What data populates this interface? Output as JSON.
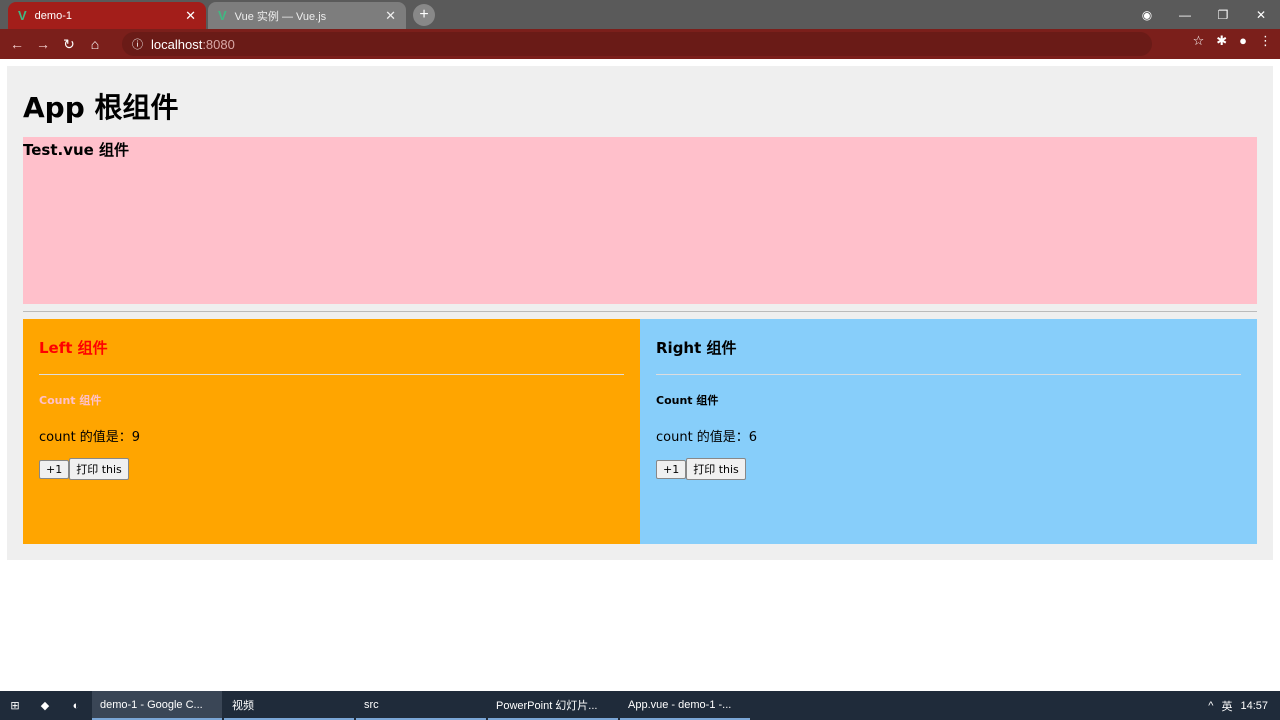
{
  "browser": {
    "tabs": [
      {
        "title": "demo-1",
        "active": true
      },
      {
        "title": "Vue 实例 — Vue.js",
        "active": false
      }
    ],
    "url_host": "localhost",
    "url_port": ":8080"
  },
  "app": {
    "title": "App 根组件",
    "test_title": "Test.vue 组件",
    "left": {
      "title": "Left 组件",
      "count_title": "Count 组件",
      "count_text": "count 的值是：9",
      "inc": "+1",
      "print": "打印 this"
    },
    "right": {
      "title": "Right 组件",
      "count_title": "Count 组件",
      "count_text": "count 的值是：6",
      "inc": "+1",
      "print": "打印 this"
    }
  },
  "taskbar": {
    "items": [
      "demo-1 - Google C...",
      "视频",
      "src",
      "PowerPoint 幻灯片...",
      "App.vue - demo-1 -..."
    ],
    "lang": "英",
    "time": "14:57"
  },
  "colors": {
    "test": "#ffc0cb",
    "left": "#ffa500",
    "right": "#87cefa"
  }
}
